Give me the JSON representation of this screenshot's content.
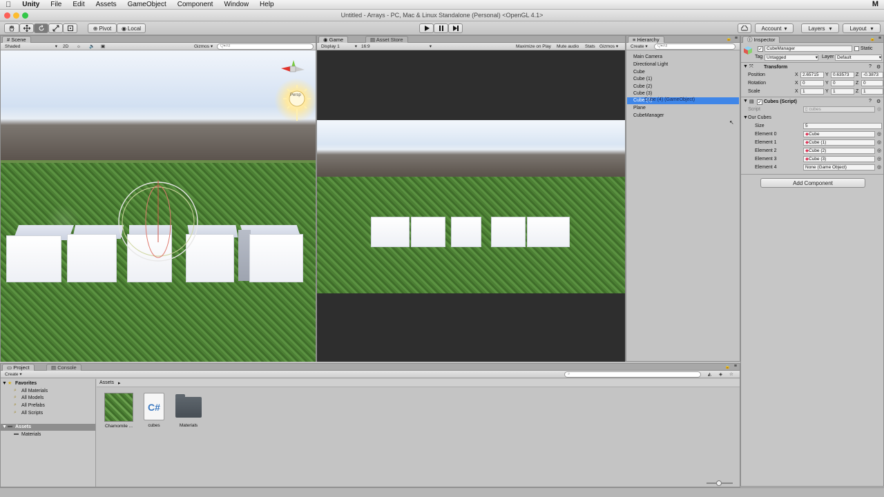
{
  "menubar": {
    "apple": "",
    "app": "Unity",
    "items": [
      "File",
      "Edit",
      "Assets",
      "GameObject",
      "Component",
      "Window",
      "Help"
    ]
  },
  "window": {
    "title": "Untitled - Arrays - PC, Mac & Linux Standalone (Personal) <OpenGL 4.1>"
  },
  "toolbar": {
    "pivot": "Pivot",
    "local": "Local",
    "account": "Account",
    "layers": "Layers",
    "layout": "Layout"
  },
  "scene": {
    "tab": "Scene",
    "shading": "Shaded",
    "mode2d": "2D",
    "gizmos": "Gizmos",
    "search": "Q▾All",
    "persp": "Persp"
  },
  "game": {
    "tab": "Game",
    "tab2": "Asset Store",
    "display": "Display 1",
    "aspect": "16:9",
    "maximize": "Maximize on Play",
    "mute": "Mute audio",
    "stats": "Stats",
    "gizmos": "Gizmos"
  },
  "hierarchy": {
    "tab": "Hierarchy",
    "create": "Create",
    "search": "Q▾All",
    "items": [
      "Main Camera",
      "Directional Light",
      "Cube",
      "Cube (1)",
      "Cube (2)",
      "Cube (3)",
      "Cube (4)",
      "Plane",
      "CubeManager"
    ],
    "drag_tooltip": "Cube (4) (GameObject)"
  },
  "inspector": {
    "tab": "Inspector",
    "name": "CubeManager",
    "static": "Static",
    "tag_label": "Tag",
    "tag": "Untagged",
    "layer_label": "Layer",
    "layer": "Default",
    "transform": {
      "title": "Transform",
      "position": {
        "label": "Position",
        "x": "2.65715",
        "y": "0.63573",
        "z": "-0.3873"
      },
      "rotation": {
        "label": "Rotation",
        "x": "0",
        "y": "0",
        "z": "0"
      },
      "scale": {
        "label": "Scale",
        "x": "1",
        "y": "1",
        "z": "1"
      }
    },
    "script": {
      "title": "Cubes (Script)",
      "script_label": "Script",
      "script_value": "cubes",
      "array_label": "Our Cubes",
      "size_label": "Size",
      "size": "5",
      "elements": [
        {
          "label": "Element 0",
          "value": "Cube"
        },
        {
          "label": "Element 1",
          "value": "Cube (1)"
        },
        {
          "label": "Element 2",
          "value": "Cube (2)"
        },
        {
          "label": "Element 3",
          "value": "Cube (3)"
        },
        {
          "label": "Element 4",
          "value": "None (Game Object)"
        }
      ]
    },
    "add_component": "Add Component"
  },
  "project": {
    "tab": "Project",
    "tab2": "Console",
    "create": "Create",
    "favorites": "Favorites",
    "favorite_items": [
      "All Materials",
      "All Models",
      "All Prefabs",
      "All Scripts"
    ],
    "assets_root": "Assets",
    "folders": [
      "Materials"
    ],
    "breadcrumb": "Assets",
    "files": [
      {
        "name": "Chamomile ...",
        "icon": "grass-texture-icon"
      },
      {
        "name": "cubes",
        "icon": "csharp-script-icon"
      },
      {
        "name": "Materials",
        "icon": "folder-icon"
      }
    ]
  },
  "colors": {
    "selection": "#3f86e8",
    "panel": "#c2c2c2",
    "sky": "#d9e6f6",
    "grass": "#4d8c3a"
  }
}
